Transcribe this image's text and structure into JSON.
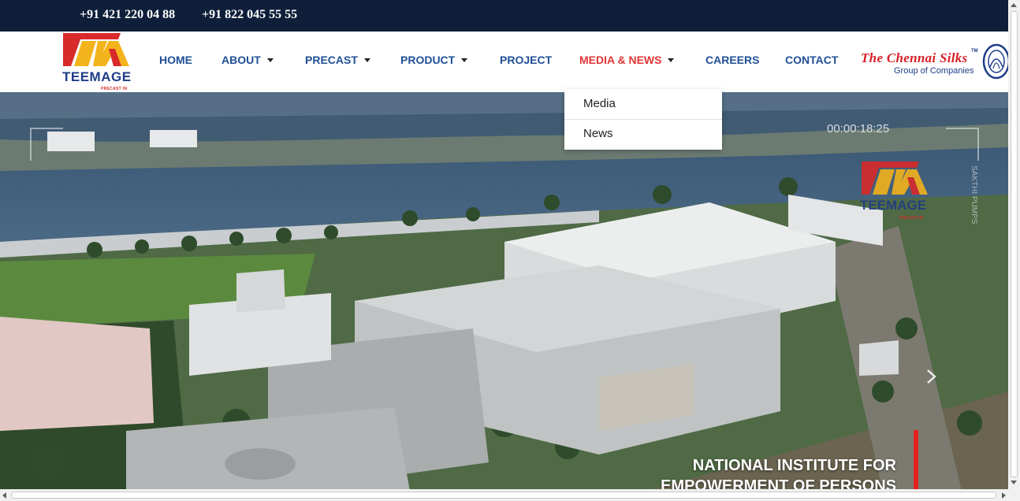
{
  "topbar": {
    "phone1": "+91 421 220 04 88",
    "phone2": "+91 822 045 55 55"
  },
  "brand": {
    "name": "TEEMAGE",
    "tagline": "PRECAST IN",
    "colors": {
      "navy": "#1f3c88",
      "red": "#d82a2a",
      "yellow": "#f3b31c"
    }
  },
  "nav": {
    "items": [
      {
        "label": "HOME"
      },
      {
        "label": "ABOUT"
      },
      {
        "label": "PRECAST"
      },
      {
        "label": "PRODUCT"
      },
      {
        "label": "PROJECT"
      },
      {
        "label": "MEDIA & NEWS"
      },
      {
        "label": "CAREERS"
      },
      {
        "label": "CONTACT"
      }
    ],
    "active_color": "#e03535",
    "color": "#1f4f96"
  },
  "partner": {
    "name": "The Chennai Silks",
    "tm": "TM",
    "subtitle": "Group of Companies"
  },
  "dropdown": {
    "items": [
      {
        "label": "Media"
      },
      {
        "label": "News"
      }
    ]
  },
  "hero": {
    "timecode": "00:00:18:25",
    "headline_line1": "NATIONAL INSTITUTE FOR",
    "headline_line2": "EMPOWERMENT OF PERSONS",
    "watermark_logo": "TEEMAGE",
    "watermark_sub": "PRECAST IN",
    "side_text": "SAKTHI PUMPS"
  }
}
